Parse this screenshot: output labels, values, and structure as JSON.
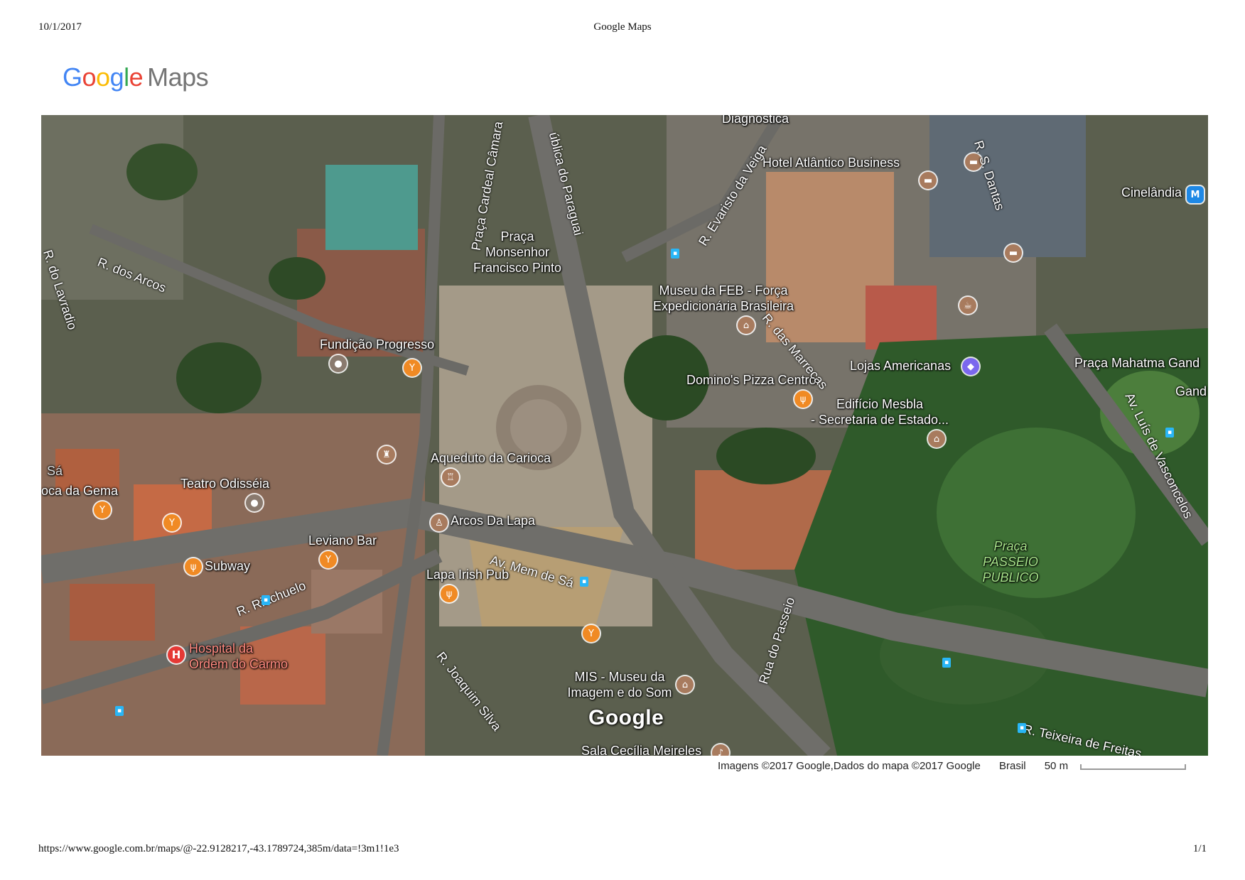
{
  "print_header": {
    "date": "10/1/2017",
    "title": "Google Maps"
  },
  "print_footer": {
    "url": "https://www.google.com.br/maps/@-22.9128217,-43.1789724,385m/data=!3m1!1e3",
    "page": "1/1"
  },
  "logo": {
    "google": "Google",
    "maps": "Maps"
  },
  "map": {
    "view": "satellite",
    "places": {
      "hotel_atlantico": "Hotel Atlântico Business",
      "cinelandia": "Cinelândia",
      "praca_monsenhor": "Praça\nMonsenhor\nFrancisco Pinto",
      "museu_feb": "Museu da FEB - Força\nExpedicionária Brasileira",
      "fundicao": "Fundição Progresso",
      "lojas_americanas": "Lojas Americanas",
      "praca_mahatma": "Praça Mahatma Gand",
      "gand": "Gand",
      "dominos": "Domino's Pizza Centro",
      "edificio_mesbla": "Edifício Mesbla\n- Secretaria de Estado...",
      "aqueduto": "Aqueduto da Carioca",
      "teatro": "Teatro Odisséia",
      "boca_gema": "oca da Gema",
      "sa": "Sá",
      "arcos_lapa": "Arcos Da Lapa",
      "leviano": "Leviano Bar",
      "subway": "Subway",
      "lapa_irish": "Lapa Irish Pub",
      "passeio_publico": "Praça\nPASSEIO\nPUBLICO",
      "hospital": "Hospital da\nOrdem do Carmo",
      "mis": "MIS - Museu da\nImagem e do Som",
      "sala_cecilia": "Sala Cecília Meireles",
      "diagnostica": "Diagnóstica"
    },
    "streets": {
      "arcos": "R. dos Arcos",
      "lavradio": "R. do Lavradio",
      "cardeal": "Praça Cardeal Câmara",
      "paraguai": "ública do Paraguai",
      "evaristo": "R. Evaristo da Veiga",
      "dantas": "R. S. Dantas",
      "marrecas": "R. das Marrecas",
      "vasconcelos": "Av. Luís de Vasconcelos",
      "mem_de_sa": "Av. Mem de Sá",
      "riachuelo": "R. Riachuelo",
      "joaquim": "R. Joaquim Silva",
      "passeio": "Rua do Passeio",
      "teixeira": "R. Teixeira de Freitas"
    },
    "watermark": "Google",
    "icons": [
      "bar-icon",
      "restaurant-icon",
      "museum-icon",
      "hotel-icon",
      "shopping-icon",
      "hospital-icon",
      "metro-icon",
      "bus-stop-icon",
      "theater-icon",
      "monument-icon"
    ]
  },
  "attribution": {
    "imagery": "Imagens ©2017 Google,Dados do mapa ©2017 Google",
    "country": "Brasil",
    "scale": "50 m"
  }
}
